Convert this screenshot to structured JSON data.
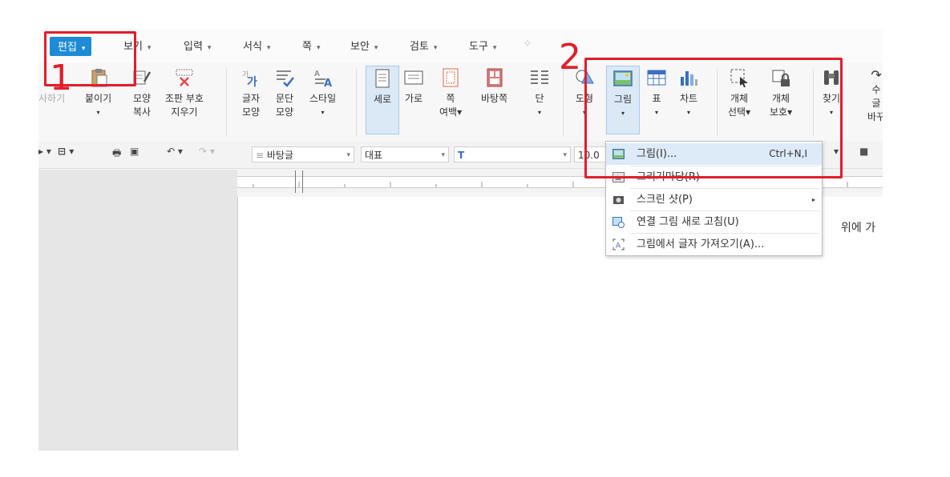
{
  "menubar": {
    "items": [
      {
        "label": "편집",
        "arrow": "▾"
      },
      {
        "label": "보기",
        "arrow": "▾"
      },
      {
        "label": "입력",
        "arrow": "▾"
      },
      {
        "label": "서식",
        "arrow": "▾"
      },
      {
        "label": "쪽",
        "arrow": "▾"
      },
      {
        "label": "보안",
        "arrow": "▾"
      },
      {
        "label": "검토",
        "arrow": "▾"
      },
      {
        "label": "도구",
        "arrow": "▾"
      }
    ]
  },
  "ribbon": {
    "copy": {
      "line1": "사하기"
    },
    "paste": {
      "line1": "붙이기",
      "line2": "▾"
    },
    "format_copy": {
      "line1": "모양",
      "line2": "복사"
    },
    "remove_markup": {
      "line1": "조판 부호",
      "line2": "지우기"
    },
    "char_shape": {
      "line1": "글자",
      "line2": "모양"
    },
    "para_shape": {
      "line1": "문단",
      "line2": "모양"
    },
    "style": {
      "line1": "스타일",
      "line2": "▾"
    },
    "portrait": {
      "line1": "세로"
    },
    "landscape": {
      "line1": "가로"
    },
    "margin": {
      "line1": "쪽",
      "line2": "여백▾"
    },
    "background": {
      "line1": "바탕쪽"
    },
    "columns": {
      "line1": "단",
      "line2": "▾"
    },
    "shape": {
      "line1": "도형",
      "line2": "▾"
    },
    "picture": {
      "line1": "그림",
      "line2": "▾"
    },
    "table": {
      "line1": "표",
      "line2": "▾"
    },
    "chart": {
      "line1": "차트",
      "line2": "▾"
    },
    "obj_select": {
      "line1": "개체",
      "line2": "선택▾"
    },
    "obj_protect": {
      "line1": "개체",
      "line2": "보호▾"
    },
    "find": {
      "line1": "찾기",
      "line2": "▾"
    },
    "replace": {
      "line1": "수",
      "line2": "글",
      "line3": "바꾸"
    }
  },
  "toolbar": {
    "style_name": "바탕글",
    "font_lang": "대표",
    "font_name": "T",
    "font_size": "10.0"
  },
  "document": {
    "text": "위에 가"
  },
  "picture_menu": {
    "items": [
      {
        "label": "그림(I)...",
        "shortcut": "Ctrl+N,I",
        "submenu": ""
      },
      {
        "label": "그리기마당(R)",
        "shortcut": "",
        "submenu": ""
      },
      {
        "label": "스크린 샷(P)",
        "shortcut": "",
        "submenu": "▸"
      },
      {
        "label": "연결 그림 새로 고침(U)",
        "shortcut": "",
        "submenu": ""
      },
      {
        "label": "그림에서 글자 가져오기(A)...",
        "shortcut": "",
        "submenu": ""
      }
    ]
  },
  "annotations": {
    "step1": "1",
    "step2": "2",
    "color": "#e21d2a"
  },
  "colors": {
    "accent": "#1e8bd8",
    "highlight": "#ddeaf8"
  }
}
